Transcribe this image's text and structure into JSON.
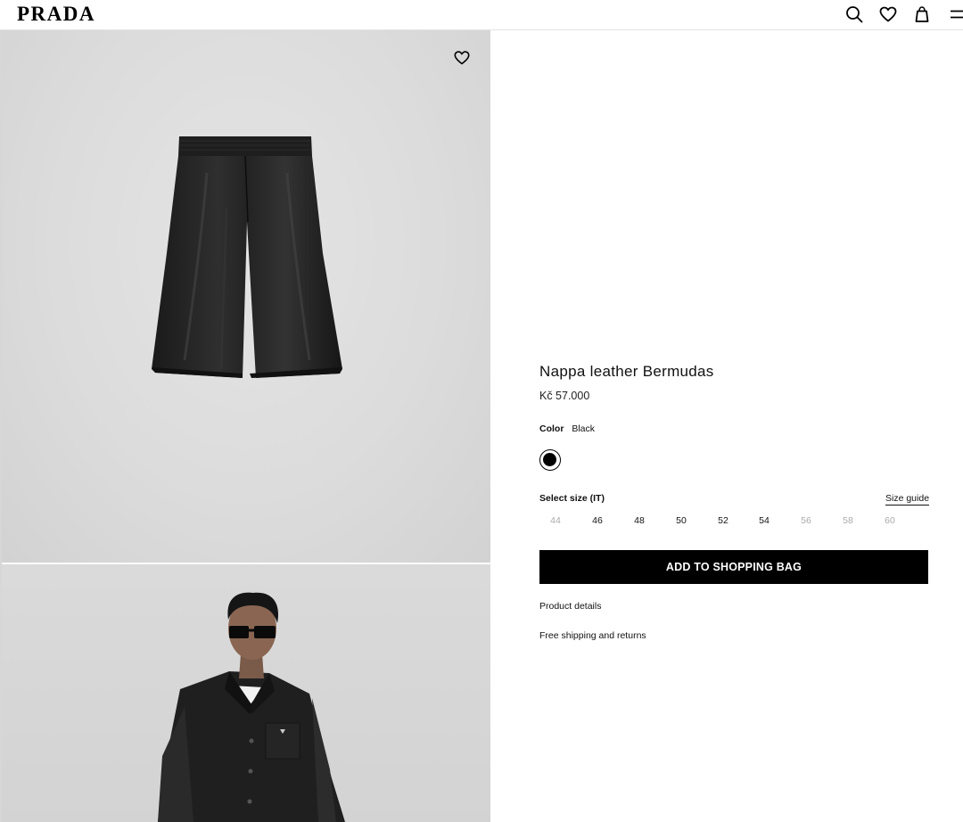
{
  "header": {
    "logo": "PRADA",
    "icons": [
      "search-icon",
      "heart-icon",
      "bag-icon",
      "menu-icon"
    ]
  },
  "gallery": {
    "wishlist_icon": "heart-icon"
  },
  "product": {
    "name": "Nappa leather Bermudas",
    "price": "Kč 57.000",
    "color_label": "Color",
    "color_value": "Black",
    "swatch_color": "#000000",
    "size_label": "Select size (IT)",
    "size_guide": "Size guide",
    "sizes": [
      {
        "value": "44",
        "available": false
      },
      {
        "value": "46",
        "available": true
      },
      {
        "value": "48",
        "available": true
      },
      {
        "value": "50",
        "available": true
      },
      {
        "value": "52",
        "available": true
      },
      {
        "value": "54",
        "available": true
      },
      {
        "value": "56",
        "available": false
      },
      {
        "value": "58",
        "available": false
      },
      {
        "value": "60",
        "available": false
      }
    ],
    "add_to_bag": "ADD TO SHOPPING BAG",
    "details_link": "Product details",
    "shipping_link": "Free shipping and returns"
  }
}
